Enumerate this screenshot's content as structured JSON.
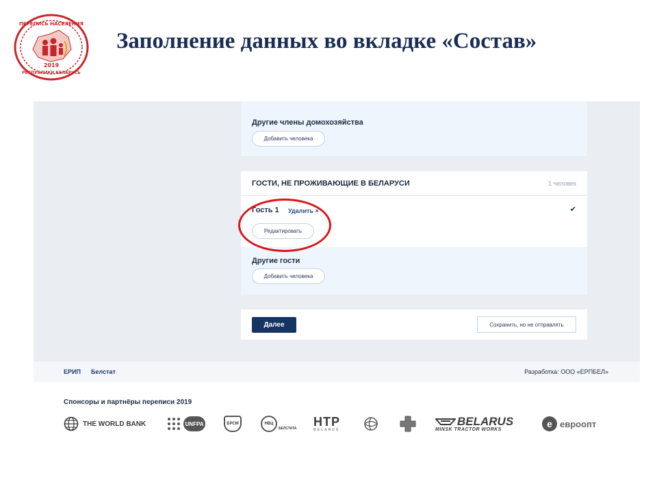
{
  "slide": {
    "title": "Заполнение данных во вкладке «Состав»",
    "logo_text_top": "ПЕРЕПИСЬ НАСЕЛЕНИЯ",
    "logo_year": "2019",
    "logo_text_bottom": "РЕСПУБЛИКИ БЕЛАРУСЬ"
  },
  "household": {
    "other_members_label": "Другие члены домохозяйства",
    "add_person_label": "Добавить человека"
  },
  "guests": {
    "title": "ГОСТИ, НЕ ПРОЖИВАЮЩИЕ В БЕЛАРУСИ",
    "count": "1 человек",
    "guest_name": "Гость 1",
    "delete_label": "Удалить ×",
    "edit_label": "Редактировать",
    "other_guests_label": "Другие гости",
    "add_person_label": "Добавить человека"
  },
  "actions": {
    "next_label": "Далее",
    "save_label": "Сохранить, но не отправлять"
  },
  "footer": {
    "link_1": "ЕРИП",
    "link_2": "Белстат",
    "developer": "Разработка: ООО «ЕРПБЕЛ»"
  },
  "sponsors": {
    "title": "Спонсоры и партнёры переписи 2019",
    "world_bank": "THE WORLD BANK",
    "unfpa": "UNFPA",
    "brsm": "БРСМ",
    "nvc": "НВЦ",
    "nvc_sub": "БЕЛСТАТА",
    "htp": "HTP",
    "htp_sub": "BELARUS",
    "belarus": "BELARUS",
    "belarus_sub": "MINSK TRACTOR WORKS",
    "evroopt": "евроопт"
  },
  "colors": {
    "title": "#1a2d55",
    "primary_button": "#143462",
    "highlight": "#d9151d",
    "section_bg": "#eff5fd"
  }
}
